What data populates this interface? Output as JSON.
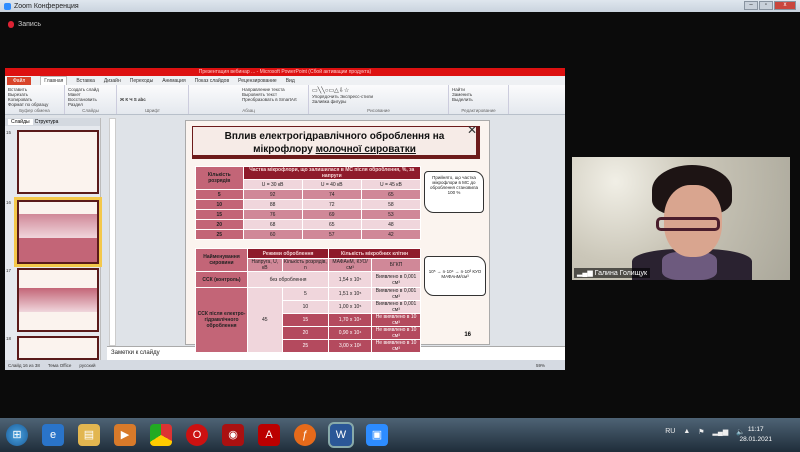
{
  "zoom": {
    "title": "Zoom Конференция",
    "recording": "Запись"
  },
  "ppt": {
    "title": "Презентация вебинар ... - Microsoft PowerPoint (Сбой активации продукта)",
    "tabs": [
      "Файл",
      "Главная",
      "Вставка",
      "Дизайн",
      "Переходы",
      "Анимация",
      "Показ слайдов",
      "Рецензирование",
      "Вид"
    ],
    "ribbon_groups": [
      {
        "label": "Буфер обмена",
        "items": [
          "Вставить",
          "Вырезать",
          "Копировать",
          "Формат по образцу"
        ]
      },
      {
        "label": "Слайды",
        "items": [
          "Создать слайд",
          "Макет",
          "Восстановить",
          "Раздел"
        ]
      },
      {
        "label": "Шрифт",
        "items": []
      },
      {
        "label": "Абзац",
        "items": [
          "Направление текста",
          "Выровнять текст",
          "Преобразовать в SmartArt"
        ]
      },
      {
        "label": "Рисование",
        "items": [
          "Упорядочить",
          "Экспресс-стили",
          "Заливка фигуры",
          "Контур фигуры",
          "Эффекты фигур"
        ]
      },
      {
        "label": "Редактирование",
        "items": [
          "Найти",
          "Заменить",
          "Выделить"
        ]
      }
    ],
    "panel_tabs": [
      "Слайды",
      "Структура"
    ],
    "thumb_numbers": [
      "15",
      "16",
      "17",
      "18"
    ],
    "notes_placeholder": "Заметки к слайду",
    "status": [
      "Слайд 16 из 38",
      "Тема Office",
      "русский"
    ],
    "zoom_level": "59%"
  },
  "slide": {
    "title_line1": "Вплив електрогідравлічного оброблення на",
    "title_line2_a": "мікрофлору ",
    "title_line2_b": "молочної сироватки",
    "table1": {
      "corner": "Кількість розрядів",
      "header": "Частка мікрофлори, що залишилася в МС після оброблення, %, за напруги",
      "cols": [
        "U = 30 кВ",
        "U = 40 кВ",
        "U = 45 кВ"
      ],
      "rows": [
        [
          "5",
          "92",
          "74",
          "65"
        ],
        [
          "10",
          "88",
          "72",
          "58"
        ],
        [
          "15",
          "76",
          "69",
          "53"
        ],
        [
          "20",
          "68",
          "65",
          "48"
        ],
        [
          "25",
          "60",
          "57",
          "42"
        ]
      ]
    },
    "note1": "Прийнято, що частка мікрофлори в МС до оброблення становила 100 %",
    "table2": {
      "col_name": "Найменування сировини",
      "group_mode": "Режими оброблення",
      "group_cells": "Кількість мікробних клітин",
      "sub": [
        "Напруга, U, кВ",
        "Кількість розрядів, n",
        "МАФАнМ, КУО/см³",
        "БГКП"
      ],
      "control": {
        "name": "ССК (контроль)",
        "mode": "без оброблення",
        "mafanm": "1,54 x 10⁵",
        "bgkp": "Виявлено в 0,001 см³"
      },
      "treated_name": "ССК після електро-гідравлічного оброблення",
      "voltage": "45",
      "rows": [
        [
          "5",
          "1,51 x 10⁵",
          "Виявлено в 0,001 см³"
        ],
        [
          "10",
          "1,00 x 10⁵",
          "Виявлено в 0,001 см³"
        ],
        [
          "15",
          "1,70 x 10⁴",
          "Не виявлено в 10 см³"
        ],
        [
          "20",
          "0,90 x 10⁴",
          "Не виявлено в 10 см³"
        ],
        [
          "25",
          "3,00 x 10³",
          "Не виявлено в 10 см³"
        ]
      ]
    },
    "note2": "10⁵ → n·10⁴ → n·10³ КУО МАФАнМ/см³",
    "page": "16"
  },
  "video": {
    "participant": "Галина Голищук"
  },
  "taskbar": {
    "lang": "RU",
    "time": "11:17",
    "date": "28.01.2021"
  }
}
